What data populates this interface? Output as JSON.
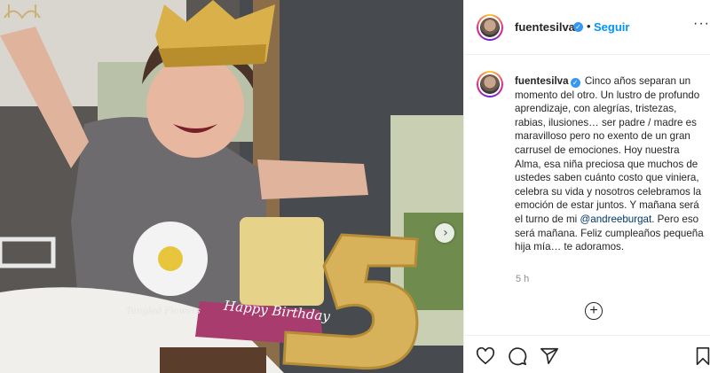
{
  "post": {
    "username": "fuentesilva",
    "follow_label": "Seguir",
    "separator": "•",
    "more_label": "···",
    "caption_text": "Cinco años separan un momento del otro. Un lustro de profundo aprendizaje, con alegrías, tristezas, rabias, ilusiones… ser padre / madre es maravilloso pero no exento de un gran carrusel de emociones. Hoy nuestra Alma, esa niña preciosa que muchos de ustedes saben cuánto costo que viniera, celebra su vida y nosotros celebramos la emoción de estar juntos. Y mañana será el turno de mi",
    "mention": "@andreeburgat",
    "caption_end": ". Pero eso será mañana. Feliz cumpleaños pequeña hija mía… te adoramos.",
    "time_ago": "5 h",
    "photo_text": {
      "cake_banner": "Happy Birthday",
      "shirt": "Tangled Flowers",
      "cake_number": "5"
    }
  },
  "icons": {
    "verified": "verified-badge-icon",
    "heart": "heart-icon",
    "comment": "comment-icon",
    "share": "share-icon",
    "bookmark": "bookmark-icon",
    "add_comments": "plus-circle-icon",
    "next": "chevron-right-icon"
  },
  "colors": {
    "link_blue": "#0095f6",
    "verified_blue": "#3897f0",
    "mention_blue": "#00376b",
    "muted_gray": "#8e8e8e"
  }
}
